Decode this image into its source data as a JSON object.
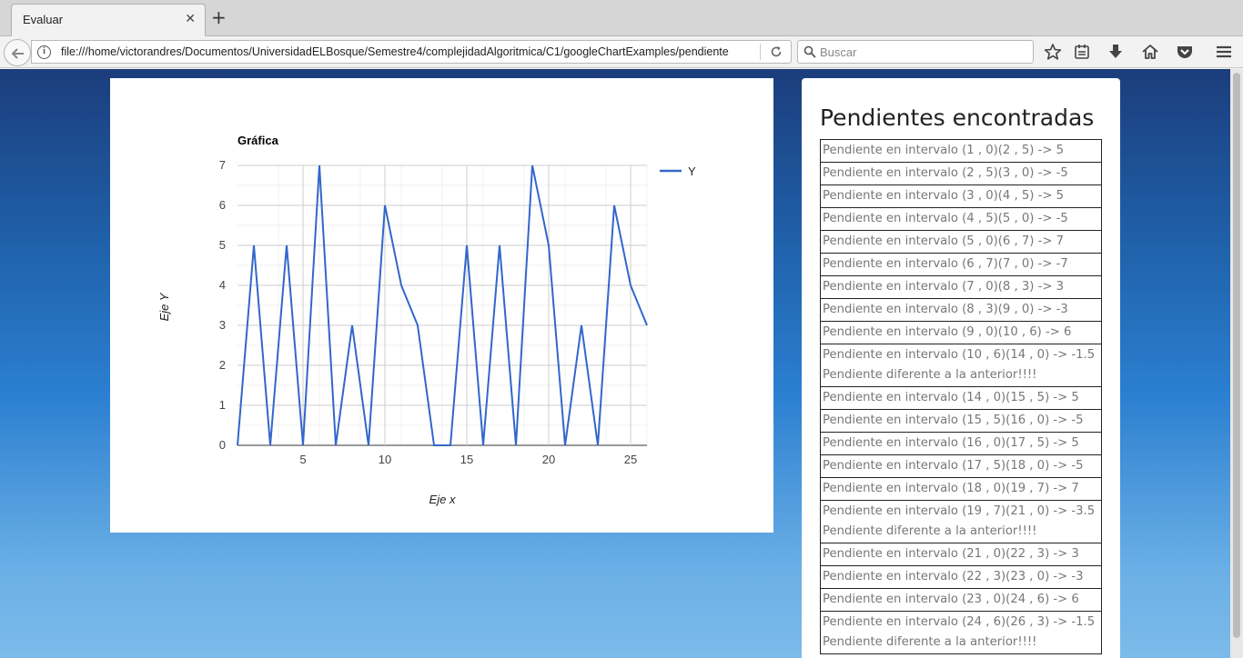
{
  "browser": {
    "tab_title": "Evaluar",
    "url": "file:///home/victorandres/Documentos/UniversidadELBosque/Semestre4/complejidadAlgoritmica/C1/googleChartExamples/pendiente",
    "search_placeholder": "Buscar"
  },
  "panel": {
    "title": "Pendientes encontradas",
    "rows": [
      "Pendiente en intervalo (1 , 0)(2 , 5) -> 5",
      "Pendiente en intervalo (2 , 5)(3 , 0) -> -5",
      "Pendiente en intervalo (3 , 0)(4 , 5) -> 5",
      "Pendiente en intervalo (4 , 5)(5 , 0) -> -5",
      "Pendiente en intervalo (5 , 0)(6 , 7) -> 7",
      "Pendiente en intervalo (6 , 7)(7 , 0) -> -7",
      "Pendiente en intervalo (7 , 0)(8 , 3) -> 3",
      "Pendiente en intervalo (8 , 3)(9 , 0) -> -3",
      "Pendiente en intervalo (9 , 0)(10 , 6) -> 6",
      "Pendiente en intervalo (10 , 6)(14 , 0) -> -1.5 Pendiente diferente a la anterior!!!!",
      "Pendiente en intervalo (14 , 0)(15 , 5) -> 5",
      "Pendiente en intervalo (15 , 5)(16 , 0) -> -5",
      "Pendiente en intervalo (16 , 0)(17 , 5) -> 5",
      "Pendiente en intervalo (17 , 5)(18 , 0) -> -5",
      "Pendiente en intervalo (18 , 0)(19 , 7) -> 7",
      "Pendiente en intervalo (19 , 7)(21 , 0) -> -3.5 Pendiente diferente a la anterior!!!!",
      "Pendiente en intervalo (21 , 0)(22 , 3) -> 3",
      "Pendiente en intervalo (22 , 3)(23 , 0) -> -3",
      "Pendiente en intervalo (23 , 0)(24 , 6) -> 6",
      "Pendiente en intervalo (24 , 6)(26 , 3) -> -1.5 Pendiente diferente a la anterior!!!!"
    ]
  },
  "chart_data": {
    "type": "line",
    "title": "Gráfica",
    "xlabel": "Eje x",
    "ylabel": "Eje Y",
    "xlim": [
      1,
      26
    ],
    "ylim": [
      0,
      7
    ],
    "xticks": [
      5,
      10,
      15,
      20,
      25
    ],
    "yticks": [
      0,
      1,
      2,
      3,
      4,
      5,
      6,
      7
    ],
    "grid": true,
    "legend": "right",
    "color": "#3366cc",
    "series": [
      {
        "name": "Y",
        "x": [
          1,
          2,
          3,
          4,
          5,
          6,
          7,
          8,
          9,
          10,
          11,
          12,
          13,
          14,
          15,
          16,
          17,
          18,
          19,
          20,
          21,
          22,
          23,
          24,
          25,
          26
        ],
        "y": [
          0,
          5,
          0,
          5,
          0,
          7,
          0,
          3,
          0,
          6,
          4,
          3,
          0,
          0,
          5,
          0,
          5,
          0,
          7,
          5,
          0,
          3,
          0,
          6,
          4,
          3
        ]
      }
    ]
  }
}
